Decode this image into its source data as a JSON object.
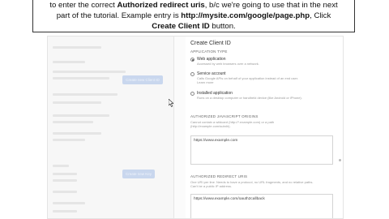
{
  "instruction": {
    "line1_prefix": "to enter the correct ",
    "line1_bold": "Authorized redirect uris",
    "line1_suffix": ", b/c we're going to use that in the next",
    "line2_prefix": "part of the tutorial. Example entry is ",
    "line2_bold": "http://mysite.com/google/page.php",
    "line2_suffix": ", Click",
    "line3_bold": "Create Client ID",
    "line3_suffix": " button."
  },
  "dialog": {
    "title": "Create Client ID",
    "app_type_label": "APPLICATION TYPE",
    "options": [
      {
        "title": "Web application",
        "desc": "Accessed by web browsers over a network.",
        "selected": true
      },
      {
        "title": "Service account",
        "desc": "Calls Google APIs on behalf of your application instead of an end user.",
        "desc2": "Learn more",
        "selected": false
      },
      {
        "title": "Installed application",
        "desc": "Runs on a desktop computer or handheld device (like Android or iPhone).",
        "selected": false
      }
    ],
    "origins_label": "AUTHORIZED JAVASCRIPT ORIGINS",
    "origins_help1": "Cannot contain a wildcard (http://*.example.com) or a path",
    "origins_help2": "(http://example.com/subdir).",
    "origins_value": "https://www.example.com",
    "redirect_label": "AUTHORIZED REDIRECT URIS",
    "redirect_help1": "One URI per line. Needs to have a protocol, no URL fragments, and no relative paths.",
    "redirect_help2": "Can't be a public IP address.",
    "redirect_value": "https://www.example.com/oauth2callback"
  },
  "left_panel": {
    "button_top": "Create new Client ID",
    "button_bottom": "Create new Key"
  },
  "colors": {
    "accent_button": "#c9d7ee",
    "border": "#333333"
  }
}
